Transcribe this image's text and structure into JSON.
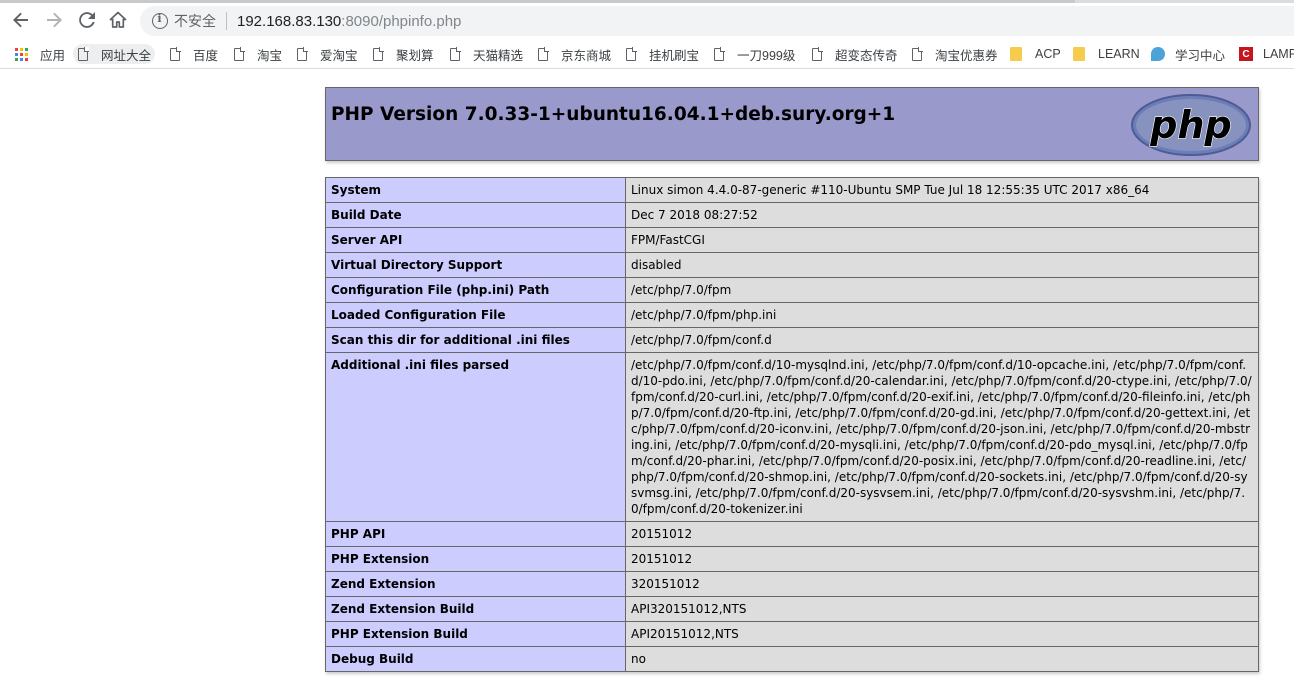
{
  "browser": {
    "address": {
      "security_label": "不安全",
      "host": "192.168.83.130",
      "path": ":8090/phpinfo.php"
    },
    "bookmarks": [
      {
        "label": "应用",
        "icon": "apps-grid-icon"
      },
      {
        "label": "网址大全",
        "icon": "page-icon"
      },
      {
        "label": "百度",
        "icon": "page-icon"
      },
      {
        "label": "淘宝",
        "icon": "page-icon"
      },
      {
        "label": "爱淘宝",
        "icon": "page-icon"
      },
      {
        "label": "聚划算",
        "icon": "page-icon"
      },
      {
        "label": "天猫精选",
        "icon": "page-icon"
      },
      {
        "label": "京东商城",
        "icon": "page-icon"
      },
      {
        "label": "挂机刷宝",
        "icon": "page-icon"
      },
      {
        "label": "一刀999级",
        "icon": "page-icon"
      },
      {
        "label": "超变态传奇",
        "icon": "page-icon"
      },
      {
        "label": "淘宝优惠券",
        "icon": "page-icon"
      },
      {
        "label": "ACP",
        "icon": "folder-icon"
      },
      {
        "label": "LEARN",
        "icon": "folder-icon"
      },
      {
        "label": "学习中心",
        "icon": "learn-icon"
      },
      {
        "label": "LAMP",
        "icon": "lamp-icon"
      }
    ]
  },
  "phpinfo": {
    "title": "PHP Version 7.0.33-1+ubuntu16.04.1+deb.sury.org+1",
    "logo_text": "php",
    "rows": [
      {
        "key": "System",
        "value": "Linux simon 4.4.0-87-generic #110-Ubuntu SMP Tue Jul 18 12:55:35 UTC 2017 x86_64"
      },
      {
        "key": "Build Date",
        "value": "Dec 7 2018 08:27:52"
      },
      {
        "key": "Server API",
        "value": "FPM/FastCGI"
      },
      {
        "key": "Virtual Directory Support",
        "value": "disabled"
      },
      {
        "key": "Configuration File (php.ini) Path",
        "value": "/etc/php/7.0/fpm"
      },
      {
        "key": "Loaded Configuration File",
        "value": "/etc/php/7.0/fpm/php.ini"
      },
      {
        "key": "Scan this dir for additional .ini files",
        "value": "/etc/php/7.0/fpm/conf.d"
      },
      {
        "key": "Additional .ini files parsed",
        "value": "/etc/php/7.0/fpm/conf.d/10-mysqlnd.ini, /etc/php/7.0/fpm/conf.d/10-opcache.ini, /etc/php/7.0/fpm/conf.d/10-pdo.ini, /etc/php/7.0/fpm/conf.d/20-calendar.ini, /etc/php/7.0/fpm/conf.d/20-ctype.ini, /etc/php/7.0/fpm/conf.d/20-curl.ini, /etc/php/7.0/fpm/conf.d/20-exif.ini, /etc/php/7.0/fpm/conf.d/20-fileinfo.ini, /etc/php/7.0/fpm/conf.d/20-ftp.ini, /etc/php/7.0/fpm/conf.d/20-gd.ini, /etc/php/7.0/fpm/conf.d/20-gettext.ini, /etc/php/7.0/fpm/conf.d/20-iconv.ini, /etc/php/7.0/fpm/conf.d/20-json.ini, /etc/php/7.0/fpm/conf.d/20-mbstring.ini, /etc/php/7.0/fpm/conf.d/20-mysqli.ini, /etc/php/7.0/fpm/conf.d/20-pdo_mysql.ini, /etc/php/7.0/fpm/conf.d/20-phar.ini, /etc/php/7.0/fpm/conf.d/20-posix.ini, /etc/php/7.0/fpm/conf.d/20-readline.ini, /etc/php/7.0/fpm/conf.d/20-shmop.ini, /etc/php/7.0/fpm/conf.d/20-sockets.ini, /etc/php/7.0/fpm/conf.d/20-sysvmsg.ini, /etc/php/7.0/fpm/conf.d/20-sysvsem.ini, /etc/php/7.0/fpm/conf.d/20-sysvshm.ini, /etc/php/7.0/fpm/conf.d/20-tokenizer.ini"
      },
      {
        "key": "PHP API",
        "value": "20151012"
      },
      {
        "key": "PHP Extension",
        "value": "20151012"
      },
      {
        "key": "Zend Extension",
        "value": "320151012"
      },
      {
        "key": "Zend Extension Build",
        "value": "API320151012,NTS"
      },
      {
        "key": "PHP Extension Build",
        "value": "API20151012,NTS"
      },
      {
        "key": "Debug Build",
        "value": "no"
      }
    ]
  },
  "colors": {
    "header_bg": "#9999cc",
    "key_bg": "#ccccff",
    "value_bg": "#dddddd"
  }
}
